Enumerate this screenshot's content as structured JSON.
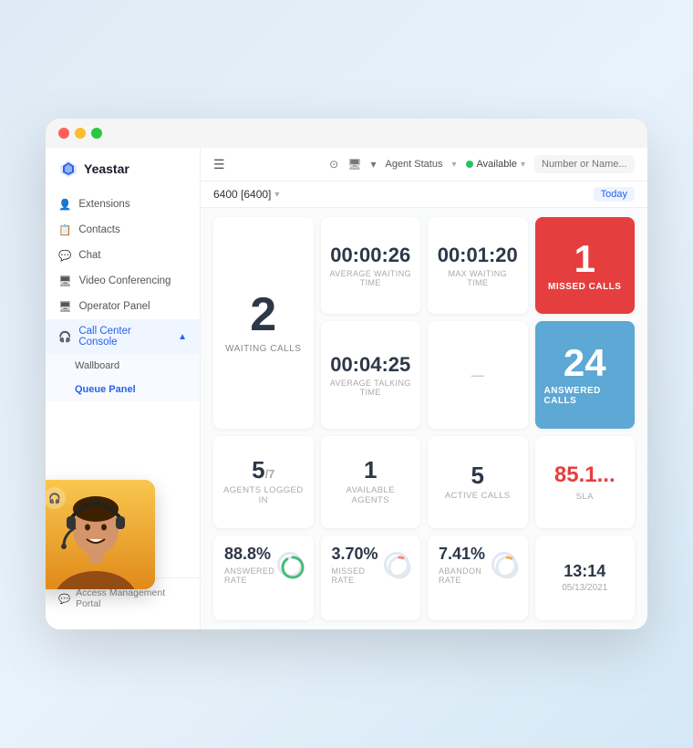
{
  "window": {
    "dots": [
      "red",
      "yellow",
      "green"
    ]
  },
  "sidebar": {
    "logo": {
      "text": "Yeastar"
    },
    "items": [
      {
        "id": "extensions",
        "label": "Extensions",
        "icon": "👤"
      },
      {
        "id": "contacts",
        "label": "Contacts",
        "icon": "📋"
      },
      {
        "id": "chat",
        "label": "Chat",
        "icon": "💬"
      },
      {
        "id": "video",
        "label": "Video Conferencing",
        "icon": "🖥"
      },
      {
        "id": "operator",
        "label": "Operator Panel",
        "icon": "🖥"
      },
      {
        "id": "callcenter",
        "label": "Call Center Console",
        "icon": "🎧",
        "active": true
      },
      {
        "id": "wallboard",
        "label": "Wallboard",
        "sub": true
      },
      {
        "id": "queue",
        "label": "Queue Panel",
        "sub": true
      }
    ],
    "bottom": "Access Management Portal"
  },
  "topbar": {
    "menu_icon": "☰",
    "icons": [
      "⊙",
      "🖥",
      "▾"
    ],
    "agent_status_label": "Agent Status",
    "available_label": "Available",
    "available_icon": "●",
    "search_placeholder": "Number or Name..."
  },
  "subbar": {
    "extension": "6400 [6400]",
    "chevron": "▾",
    "today_label": "Today"
  },
  "dashboard": {
    "waiting_calls": {
      "number": "2",
      "label": "WAITING CALLS"
    },
    "avg_waiting": {
      "value": "00:00:26",
      "label": "AVERAGE WAITING TIME"
    },
    "avg_talking": {
      "value": "00:04:25",
      "label": "AVERAGE TALKING TIME"
    },
    "max_waiting": {
      "value": "00:01:20",
      "label": "MAX WAITING TIME"
    },
    "missed_calls": {
      "number": "1",
      "label": "MISSED CALLS"
    },
    "answered_calls": {
      "number": "24",
      "label": "ANSWERED CALLS"
    },
    "agents_logged": {
      "number": "5",
      "total": "/7",
      "label": "AGENTS LOGGED IN"
    },
    "available_agents": {
      "number": "1",
      "label": "AVAILABLE AGENTS"
    },
    "active_calls": {
      "number": "5",
      "label": "ACTIVE CALLS"
    },
    "sla": {
      "number": "85.1...",
      "label": "SLA"
    },
    "answered_rate": {
      "value": "88.8%",
      "label": "ANSWERED RATE"
    },
    "missed_rate": {
      "value": "3.70%",
      "label": "MISSED RATE"
    },
    "abandon_rate": {
      "value": "7.41%",
      "label": "ABANDON RATE"
    },
    "datetime": {
      "time": "13:14",
      "date": "05/13/2021"
    }
  },
  "agent": {
    "icon": "🎧"
  }
}
